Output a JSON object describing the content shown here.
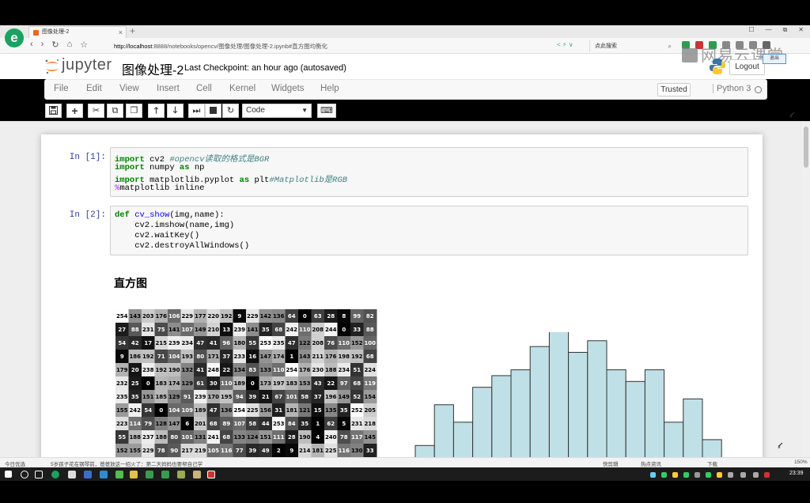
{
  "browser": {
    "tab_title": "图像处理-2",
    "new_tab_symbol": "+",
    "close_symbol": "×",
    "url_host": "http://localhost",
    "url_path": ":8888/notebooks/opencv/图像处理/图像处理-2.ipynb#直方图均衡化",
    "search_placeholder": "点此搜索",
    "nav": {
      "back": "‹",
      "forward": "›",
      "reload": "↻",
      "home": "⌂",
      "star": "☆"
    },
    "window_controls": [
      "☐",
      "—",
      "⧉",
      "✕"
    ]
  },
  "jupyter": {
    "logo_text": "jupyter",
    "notebook_name": "图像处理-2",
    "checkpoint": "Last Checkpoint: an hour ago (autosaved)",
    "logout": "Logout",
    "logout_tip": "退出",
    "watermark": "网易云课堂"
  },
  "menubar": {
    "items": [
      "File",
      "Edit",
      "View",
      "Insert",
      "Cell",
      "Kernel",
      "Widgets",
      "Help"
    ],
    "trusted": "Trusted",
    "kernel": "Python 3"
  },
  "toolbar": {
    "buttons": [
      "save",
      "insert-cell-below",
      "cut",
      "copy",
      "paste",
      "move-up",
      "move-down",
      "run",
      "interrupt",
      "restart",
      "command-palette"
    ],
    "cell_type": "Code"
  },
  "cells": [
    {
      "prompt": "In [1]:",
      "lines": [
        [
          {
            "t": "import",
            "c": "kw"
          },
          {
            "t": " cv2 "
          },
          {
            "t": "#opencv读取的格式是BGR",
            "c": "cm"
          }
        ],
        [
          {
            "t": "import",
            "c": "kw"
          },
          {
            "t": " numpy "
          },
          {
            "t": "as",
            "c": "kw"
          },
          {
            "t": " np"
          }
        ],
        [
          {
            "t": "import",
            "c": "kw"
          },
          {
            "t": " matplotlib.pyplot "
          },
          {
            "t": "as",
            "c": "kw"
          },
          {
            "t": " plt"
          },
          {
            "t": "#Matplotlib是RGB",
            "c": "cm"
          }
        ],
        [
          {
            "t": "%",
            "c": "mg"
          },
          {
            "t": "matplotlib inline"
          }
        ]
      ]
    },
    {
      "prompt": "In [2]:",
      "lines": [
        [
          {
            "t": "def",
            "c": "kw"
          },
          {
            "t": " "
          },
          {
            "t": "cv_show",
            "c": "fn"
          },
          {
            "t": "(img,name):"
          }
        ],
        [
          {
            "t": "    cv2.imshow(name,img)"
          }
        ],
        [
          {
            "t": "    cv2.waitKey()"
          }
        ],
        [
          {
            "t": "    cv2.destroyAllWindows()"
          }
        ]
      ]
    }
  ],
  "markdown_heading": "直方图",
  "pixel_matrix": [
    [
      "254",
      "143",
      "203",
      "176",
      "106",
      "229",
      "177",
      "220",
      "192",
      "9",
      "229",
      "142",
      "136",
      "64",
      "0",
      "63",
      "28",
      "8",
      "99",
      "82"
    ],
    [
      "27",
      "88",
      "231",
      "75",
      "141",
      "107",
      "149",
      "210",
      "13",
      "239",
      "141",
      "35",
      "68",
      "242",
      "110",
      "208",
      "244",
      "0",
      "33",
      "88"
    ],
    [
      "54",
      "42",
      "17",
      "215",
      "239",
      "234",
      "47",
      "41",
      "96",
      "180",
      "55",
      "253",
      "235",
      "47",
      "122",
      "208",
      "76",
      "110",
      "152",
      "100"
    ],
    [
      "9",
      "186",
      "192",
      "71",
      "104",
      "193",
      "80",
      "171",
      "37",
      "233",
      "16",
      "147",
      "174",
      "1",
      "143",
      "211",
      "176",
      "198",
      "192",
      "68"
    ],
    [
      "179",
      "20",
      "238",
      "192",
      "190",
      "132",
      "41",
      "248",
      "22",
      "134",
      "83",
      "133",
      "110",
      "254",
      "176",
      "230",
      "188",
      "234",
      "51",
      "224"
    ],
    [
      "232",
      "25",
      "0",
      "183",
      "174",
      "129",
      "61",
      "30",
      "110",
      "189",
      "0",
      "173",
      "197",
      "183",
      "153",
      "43",
      "22",
      "97",
      "68",
      "119"
    ],
    [
      "235",
      "35",
      "151",
      "185",
      "129",
      "91",
      "239",
      "170",
      "195",
      "94",
      "39",
      "21",
      "67",
      "101",
      "58",
      "37",
      "196",
      "149",
      "52",
      "154"
    ],
    [
      "155",
      "242",
      "54",
      "0",
      "104",
      "109",
      "189",
      "47",
      "136",
      "254",
      "225",
      "156",
      "31",
      "181",
      "121",
      "15",
      "135",
      "35",
      "252",
      "205"
    ],
    [
      "223",
      "114",
      "79",
      "128",
      "147",
      "6",
      "201",
      "68",
      "89",
      "107",
      "58",
      "44",
      "253",
      "84",
      "35",
      "1",
      "62",
      "5",
      "231",
      "218"
    ],
    [
      "55",
      "188",
      "237",
      "188",
      "80",
      "101",
      "131",
      "241",
      "68",
      "133",
      "124",
      "151",
      "111",
      "28",
      "190",
      "4",
      "240",
      "78",
      "117",
      "145"
    ],
    [
      "152",
      "155",
      "229",
      "78",
      "90",
      "217",
      "219",
      "105",
      "116",
      "77",
      "39",
      "49",
      "2",
      "9",
      "214",
      "181",
      "225",
      "116",
      "130",
      "33"
    ]
  ],
  "chart_data": {
    "type": "bar",
    "title": "",
    "xlabel": "",
    "ylabel": "",
    "values": [
      2,
      9,
      6,
      12,
      14,
      15,
      19,
      22,
      18,
      20,
      15,
      13,
      15,
      6,
      10,
      3
    ],
    "color": "#bfe0e6",
    "edge_color": "#333333"
  },
  "statusbar": {
    "left1": "今日优选",
    "left2": "5岁孩子花在钢琴前，爸爸放这一招火了：第二天妈妈也要帮自己学",
    "right1": "快剪辑",
    "right2": "热点资讯",
    "right3": "下载",
    "zoom": "150%"
  },
  "taskbar": {
    "clock": "23:39"
  },
  "colors": {
    "accent_blue": "#303f9f",
    "jupyter_orange": "#f37626",
    "browser_green": "#1aa260"
  }
}
